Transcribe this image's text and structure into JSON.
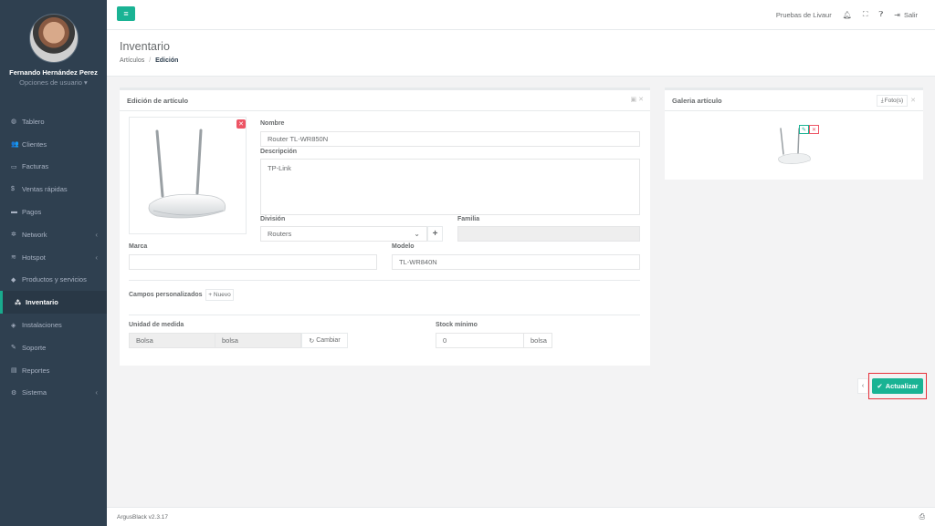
{
  "user": {
    "name": "Fernando Hernández Perez",
    "options": "Opciones de usuario ▾"
  },
  "nav": [
    {
      "label": "Tablero",
      "icon": "dashboard-icon",
      "glyph": "◍"
    },
    {
      "label": "Clientes",
      "icon": "users-icon",
      "glyph": "👥"
    },
    {
      "label": "Facturas",
      "icon": "file-icon",
      "glyph": "▭"
    },
    {
      "label": "Ventas rápidas",
      "icon": "dollar-icon",
      "glyph": "$"
    },
    {
      "label": "Pagos",
      "icon": "money-icon",
      "glyph": "▬"
    },
    {
      "label": "Network",
      "icon": "network-icon",
      "glyph": "✲",
      "chev": "‹"
    },
    {
      "label": "Hotspot",
      "icon": "wifi-icon",
      "glyph": "≋",
      "chev": "‹"
    },
    {
      "label": "Productos y servicios",
      "icon": "tag-icon",
      "glyph": "◆"
    },
    {
      "label": "Inventario",
      "icon": "cubes-icon",
      "glyph": "⁂",
      "active": true
    },
    {
      "label": "Instalaciones",
      "icon": "install-icon",
      "glyph": "◈"
    },
    {
      "label": "Soporte",
      "icon": "wrench-icon",
      "glyph": "✎"
    },
    {
      "label": "Reportes",
      "icon": "book-icon",
      "glyph": "▤"
    },
    {
      "label": "Sistema",
      "icon": "cogs-icon",
      "glyph": "⚙",
      "chev": "‹"
    }
  ],
  "topbar": {
    "company": "Pruebas de Livaur",
    "logout": "Salir"
  },
  "header": {
    "title": "Inventario",
    "crumb1": "Artículos",
    "crumb_sep": "/",
    "crumb2": "Edición"
  },
  "edit_panel": {
    "title": "Edición de artículo",
    "labels": {
      "nombre": "Nombre",
      "descripcion": "Descripción",
      "division": "División",
      "familia": "Familia",
      "marca": "Marca",
      "modelo": "Modelo",
      "custom": "Campos personalizados",
      "nuevo": "+ Nuevo",
      "unidad": "Unidad de medida",
      "stock": "Stock mínimo",
      "cambiar": "Cambiar"
    },
    "values": {
      "nombre": "Router TL-WR850N",
      "descripcion": "TP-Link",
      "division": "Routers",
      "familia": "",
      "marca": "",
      "modelo": "TL-WR840N",
      "unidad1": "Bolsa",
      "unidad2": "bolsa",
      "stock": "0",
      "stock_unit": "bolsa"
    }
  },
  "gallery_panel": {
    "title": "Galeria artículo",
    "photos_btn": "Foto(s)"
  },
  "actions": {
    "update": "Actualizar"
  },
  "footer": {
    "version": "ArgusBlack v2.3.17"
  },
  "colors": {
    "accent": "#1ab394",
    "danger": "#ed5565",
    "sidebar": "#2f4050"
  }
}
